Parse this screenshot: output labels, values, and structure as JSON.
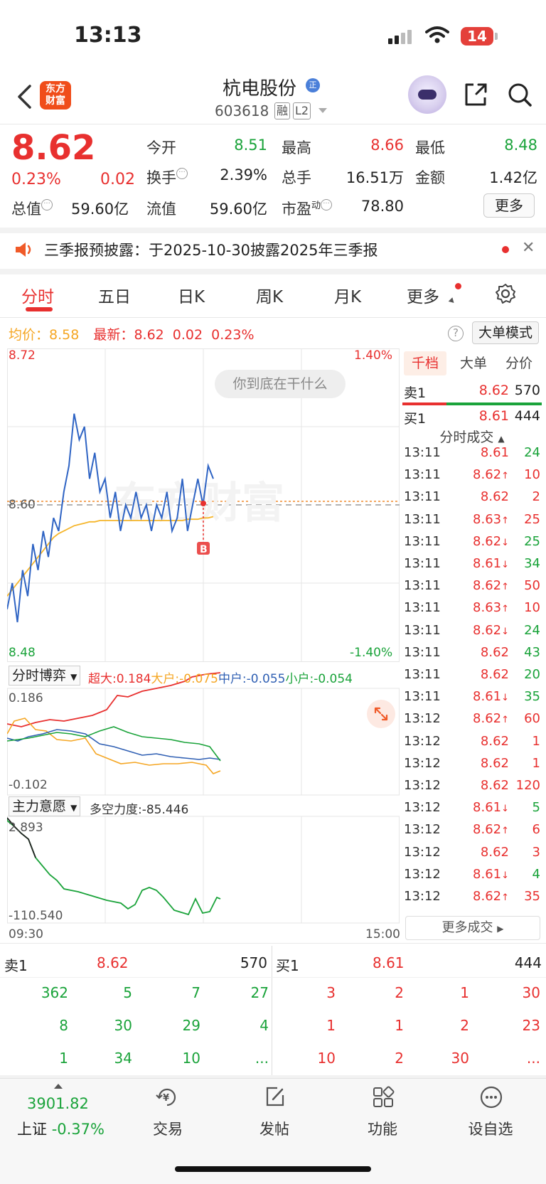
{
  "status_bar": {
    "time": "13:13",
    "battery": "14"
  },
  "header": {
    "brand": [
      "东方",
      "财富"
    ],
    "stock_name": "杭电股份",
    "name_badge": "正",
    "stock_code": "603618",
    "tag_rong": "融",
    "tag_l2": "L2"
  },
  "quote": {
    "price": "8.62",
    "change_pct": "0.23%",
    "change_amt": "0.02",
    "mcap_label": "总值",
    "mcap_value": "59.60亿",
    "fields": [
      {
        "label": "今开",
        "value": "8.51",
        "color": "green"
      },
      {
        "label": "最高",
        "value": "8.66",
        "color": "red"
      },
      {
        "label": "最低",
        "value": "8.48",
        "color": "green"
      },
      {
        "label": "换手",
        "value": "2.39%",
        "color": "black"
      },
      {
        "label": "总手",
        "value": "16.51万",
        "color": "black"
      },
      {
        "label": "金额",
        "value": "1.42亿",
        "color": "black"
      },
      {
        "label": "流值",
        "value": "59.60亿",
        "color": "black"
      },
      {
        "label": "市盈",
        "value": "78.80",
        "color": "black"
      }
    ],
    "pe_sup": "动",
    "more_button": "更多"
  },
  "notice": {
    "text": "三季报预披露：于2025-10-30披露2025年三季报",
    "close": "✕"
  },
  "tabs": [
    "分时",
    "五日",
    "日K",
    "周K",
    "月K",
    "更多"
  ],
  "avg_row": {
    "avg_label": "均价：",
    "avg_value": "8.58",
    "latest_label": "最新：",
    "latest_value": "8.62",
    "latest_change": "0.02",
    "latest_pct": "0.23%"
  },
  "big_order_mode": "大单模式",
  "chart": {
    "y_top": "8.72",
    "y_bottom": "8.48",
    "y_mid": "8.60",
    "pct_top": "1.40%",
    "pct_bottom": "-1.40%",
    "watermark": "东方财富",
    "bubble": "你到底在干什么",
    "buy_marker": "B",
    "time_start": "09:30",
    "time_end": "15:00"
  },
  "chart_data": {
    "type": "line",
    "title": "",
    "ylim": [
      8.48,
      8.72
    ],
    "series": [
      {
        "name": "",
        "values": [
          8.52,
          8.54,
          8.51,
          8.55,
          8.53,
          8.57,
          8.55,
          8.58,
          8.56,
          8.59,
          8.58,
          8.61,
          8.63,
          8.67,
          8.65,
          8.66,
          8.62,
          8.64,
          8.61,
          8.62,
          8.59,
          8.61,
          8.58,
          8.6,
          8.59,
          8.61,
          8.59,
          8.6,
          8.58,
          8.6,
          8.59,
          8.61,
          8.58,
          8.59,
          8.62,
          8.58,
          8.6,
          8.62,
          8.6,
          8.63,
          8.62
        ]
      },
      {
        "name": "",
        "values": [
          8.53,
          8.535,
          8.54,
          8.545,
          8.55,
          8.555,
          8.56,
          8.565,
          8.57,
          8.575,
          8.578,
          8.58,
          8.582,
          8.584,
          8.585,
          8.586,
          8.587,
          8.587,
          8.588,
          8.588,
          8.588,
          8.588,
          8.588,
          8.588,
          8.588,
          8.588,
          8.588,
          8.588,
          8.588,
          8.588,
          8.588,
          8.588,
          8.588,
          8.588,
          8.588,
          8.589,
          8.589,
          8.589,
          8.59,
          8.59,
          8.591
        ]
      }
    ]
  },
  "sub1": {
    "select": "分时博弈",
    "chaoda": "超大:0.184",
    "dahu": "大户:-0.075",
    "zhonghu": "中户:-0.055",
    "xiaohu": "小户:-0.054",
    "top": "0.186",
    "bottom": "-0.102"
  },
  "sub2": {
    "select": "主力意愿",
    "force": "多空力度:-85.446",
    "top": "2.893",
    "bottom": "-110.540"
  },
  "orderbook": {
    "tabs": [
      "千档",
      "大单",
      "分价"
    ],
    "sell1": {
      "label": "卖1",
      "price": "8.62",
      "vol": "570"
    },
    "buy1": {
      "label": "买1",
      "price": "8.61",
      "vol": "444"
    },
    "trades_title": "分时成交",
    "trades": [
      {
        "t": "13:11",
        "p": "8.61",
        "d": "",
        "v": "24",
        "pc": "red",
        "vc": "green"
      },
      {
        "t": "13:11",
        "p": "8.62",
        "d": "↑",
        "v": "10",
        "pc": "red",
        "vc": "red"
      },
      {
        "t": "13:11",
        "p": "8.62",
        "d": "",
        "v": "2",
        "pc": "red",
        "vc": "red"
      },
      {
        "t": "13:11",
        "p": "8.63",
        "d": "↑",
        "v": "25",
        "pc": "red",
        "vc": "red"
      },
      {
        "t": "13:11",
        "p": "8.62",
        "d": "↓",
        "v": "25",
        "pc": "red",
        "vc": "green"
      },
      {
        "t": "13:11",
        "p": "8.61",
        "d": "↓",
        "v": "34",
        "pc": "red",
        "vc": "green"
      },
      {
        "t": "13:11",
        "p": "8.62",
        "d": "↑",
        "v": "50",
        "pc": "red",
        "vc": "red"
      },
      {
        "t": "13:11",
        "p": "8.63",
        "d": "↑",
        "v": "10",
        "pc": "red",
        "vc": "red"
      },
      {
        "t": "13:11",
        "p": "8.62",
        "d": "↓",
        "v": "24",
        "pc": "red",
        "vc": "green"
      },
      {
        "t": "13:11",
        "p": "8.62",
        "d": "",
        "v": "43",
        "pc": "red",
        "vc": "green"
      },
      {
        "t": "13:11",
        "p": "8.62",
        "d": "",
        "v": "20",
        "pc": "red",
        "vc": "green"
      },
      {
        "t": "13:11",
        "p": "8.61",
        "d": "↓",
        "v": "35",
        "pc": "red",
        "vc": "green"
      },
      {
        "t": "13:12",
        "p": "8.62",
        "d": "↑",
        "v": "60",
        "pc": "red",
        "vc": "red"
      },
      {
        "t": "13:12",
        "p": "8.62",
        "d": "",
        "v": "1",
        "pc": "red",
        "vc": "red"
      },
      {
        "t": "13:12",
        "p": "8.62",
        "d": "",
        "v": "1",
        "pc": "red",
        "vc": "red"
      },
      {
        "t": "13:12",
        "p": "8.62",
        "d": "",
        "v": "120",
        "pc": "red",
        "vc": "red"
      },
      {
        "t": "13:12",
        "p": "8.61",
        "d": "↓",
        "v": "5",
        "pc": "red",
        "vc": "green"
      },
      {
        "t": "13:12",
        "p": "8.62",
        "d": "↑",
        "v": "6",
        "pc": "red",
        "vc": "red"
      },
      {
        "t": "13:12",
        "p": "8.62",
        "d": "",
        "v": "3",
        "pc": "red",
        "vc": "red"
      },
      {
        "t": "13:12",
        "p": "8.61",
        "d": "↓",
        "v": "4",
        "pc": "red",
        "vc": "green"
      },
      {
        "t": "13:12",
        "p": "8.62",
        "d": "↑",
        "v": "35",
        "pc": "red",
        "vc": "red"
      }
    ],
    "more_trades": "更多成交"
  },
  "depth": {
    "sell_label": "卖1",
    "sell_price": "8.62",
    "sell_vol": "570",
    "buy_label": "买1",
    "buy_price": "8.61",
    "buy_vol": "444",
    "sell_queue": [
      [
        "362",
        "5",
        "7",
        "27"
      ],
      [
        "8",
        "30",
        "29",
        "4"
      ],
      [
        "1",
        "34",
        "10",
        "..."
      ]
    ],
    "buy_queue": [
      [
        "3",
        "2",
        "1",
        "30"
      ],
      [
        "1",
        "1",
        "2",
        "23"
      ],
      [
        "10",
        "2",
        "30",
        "..."
      ]
    ]
  },
  "bottom_nav": {
    "index_value": "3901.82",
    "index_label": "上证",
    "index_change": "-0.37%",
    "items": [
      "交易",
      "发帖",
      "功能",
      "设自选"
    ]
  }
}
